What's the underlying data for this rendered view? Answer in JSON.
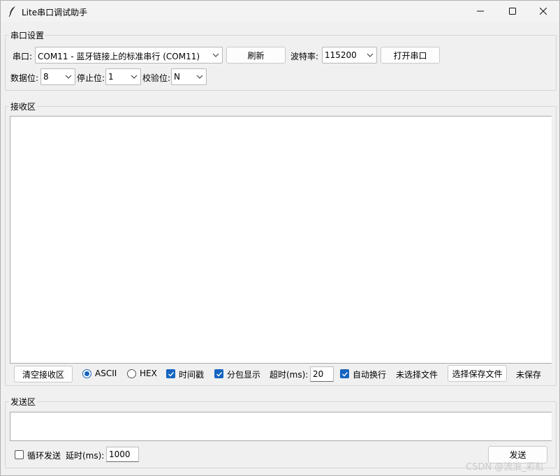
{
  "window": {
    "title": "Lite串口调试助手",
    "icon": "feather-icon"
  },
  "serial_settings": {
    "group_label": "串口设置",
    "port_label": "串口:",
    "port_value": "COM11 - 蓝牙链接上的标准串行 (COM11)",
    "refresh_label": "刷新",
    "baud_label": "波特率:",
    "baud_value": "115200",
    "open_label": "打开串口",
    "databits_label": "数据位:",
    "databits_value": "8",
    "stopbits_label": "停止位:",
    "stopbits_value": "1",
    "parity_label": "校验位:",
    "parity_value": "N"
  },
  "receive": {
    "group_label": "接收区",
    "content": "",
    "clear_label": "清空接收区",
    "ascii_label": "ASCII",
    "ascii_selected": true,
    "hex_label": "HEX",
    "timestamp_label": "时间戳",
    "timestamp_checked": true,
    "split_label": "分包显示",
    "split_checked": true,
    "timeout_label": "超时(ms):",
    "timeout_value": "20",
    "autowrap_label": "自动换行",
    "autowrap_checked": true,
    "file_status": "未选择文件",
    "choose_file_label": "选择保存文件",
    "save_status": "未保存"
  },
  "send": {
    "group_label": "发送区",
    "content": "",
    "loop_label": "循环发送",
    "loop_checked": false,
    "delay_label": "延时(ms):",
    "delay_value": "1000",
    "send_label": "发送"
  },
  "watermark": "CSDN @流浪_彩虹",
  "colors": {
    "accent": "#1565c0",
    "background": "#f0f0f0"
  }
}
